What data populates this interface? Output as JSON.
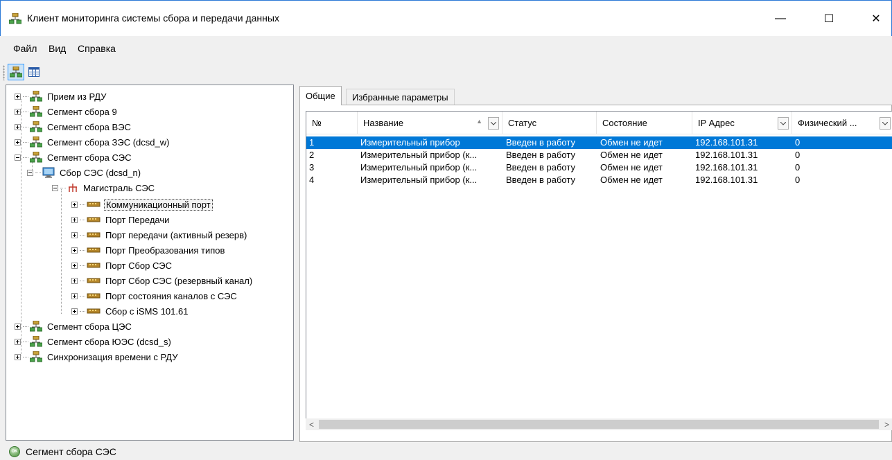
{
  "window": {
    "title": "Клиент мониторинга системы сбора и передачи данных",
    "controls": {
      "minimize": "—",
      "maximize": "☐",
      "close": "✕"
    }
  },
  "menu": [
    "Файл",
    "Вид",
    "Справка"
  ],
  "toolbar": {
    "buttons": [
      "tree-view-icon",
      "table-view-icon"
    ]
  },
  "tree": {
    "nodes": [
      {
        "label": "Прием из РДУ",
        "icon": "network-icon",
        "expander": "plus"
      },
      {
        "label": "Сегмент сбора 9",
        "icon": "network-icon",
        "expander": "plus"
      },
      {
        "label": "Сегмент сбора ВЭС",
        "icon": "network-icon",
        "expander": "plus"
      },
      {
        "label": "Сегмент сбора ЗЭС (dcsd_w)",
        "icon": "network-icon",
        "expander": "plus"
      },
      {
        "label": "Сегмент сбора СЭС",
        "icon": "network-icon",
        "expander": "minus"
      },
      {
        "label": "Сбор СЭС (dcsd_n)",
        "icon": "monitor-icon",
        "expander": "minus"
      },
      {
        "label": "Магистраль СЭС",
        "icon": "bus-icon",
        "expander": "minus"
      },
      {
        "label": "Коммуникационный порт",
        "icon": "port-icon",
        "expander": "plus",
        "selected": true
      },
      {
        "label": "Порт Передачи",
        "icon": "port-icon",
        "expander": "plus"
      },
      {
        "label": "Порт передачи (активный резерв)",
        "icon": "port-icon",
        "expander": "plus"
      },
      {
        "label": "Порт Преобразования типов",
        "icon": "port-icon",
        "expander": "plus"
      },
      {
        "label": "Порт Сбор СЭС",
        "icon": "port-icon",
        "expander": "plus"
      },
      {
        "label": "Порт Сбор СЭС (резервный канал)",
        "icon": "port-icon",
        "expander": "plus"
      },
      {
        "label": "Порт состояния каналов с СЭС",
        "icon": "port-icon",
        "expander": "plus"
      },
      {
        "label": "Сбор с iSMS 101.61",
        "icon": "port-icon",
        "expander": "plus"
      },
      {
        "label": "Сегмент сбора ЦЭС",
        "icon": "network-icon",
        "expander": "plus"
      },
      {
        "label": "Сегмент сбора ЮЭС (dcsd_s)",
        "icon": "network-icon",
        "expander": "plus"
      },
      {
        "label": "Синхронизация времени с РДУ",
        "icon": "network-icon",
        "expander": "plus"
      }
    ]
  },
  "tabs": [
    {
      "label": "Общие",
      "active": true
    },
    {
      "label": "Избранные параметры",
      "active": false
    }
  ],
  "table": {
    "columns": [
      "№",
      "Название",
      "Статус",
      "Состояние",
      "IP Адрес",
      "Физический ..."
    ],
    "rows": [
      [
        "1",
        "Измерительный прибор",
        "Введен в работу",
        "Обмен не идет",
        "192.168.101.31",
        "0"
      ],
      [
        "2",
        "Измерительный прибор (к...",
        "Введен в работу",
        "Обмен не идет",
        "192.168.101.31",
        "0"
      ],
      [
        "3",
        "Измерительный прибор (к...",
        "Введен в работу",
        "Обмен не идет",
        "192.168.101.31",
        "0"
      ],
      [
        "4",
        "Измерительный прибор (к...",
        "Введен в работу",
        "Обмен не идет",
        "192.168.101.31",
        "0"
      ]
    ],
    "selected_row": 0,
    "scroll": {
      "left": "<",
      "right": ">"
    }
  },
  "status": {
    "icon": "ok-status-icon",
    "icon_text": "OK",
    "text": "Сегмент сбора СЭС"
  },
  "colors": {
    "selection": "#0078d7",
    "window_border": "#2b79d6",
    "port_icon": "#b5862a",
    "network_icon": "#c8a23a"
  }
}
